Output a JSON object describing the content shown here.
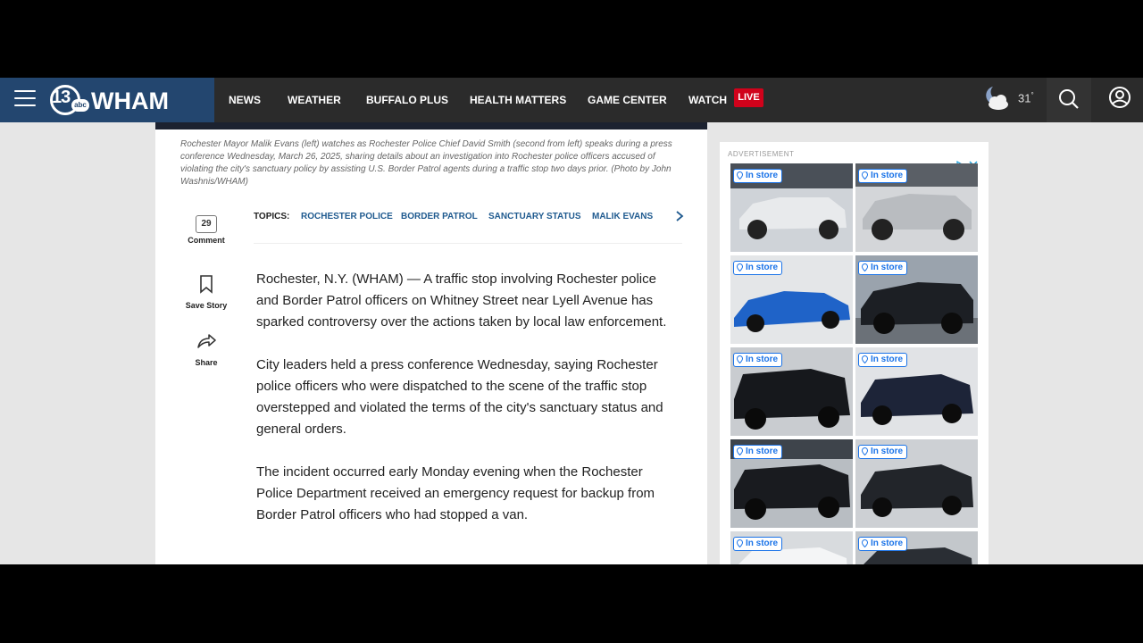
{
  "nav": {
    "brand": {
      "number": "13",
      "network": "abc",
      "name": "WHAM"
    },
    "items": [
      "NEWS",
      "WEATHER",
      "BUFFALO PLUS",
      "HEALTH MATTERS",
      "GAME CENTER",
      "WATCH"
    ],
    "live_label": "LIVE",
    "weather": {
      "temp": "31",
      "unit": "°",
      "icon": "partly-cloudy-night-icon"
    }
  },
  "article": {
    "caption": "Rochester Mayor Malik Evans (left) watches as Rochester Police Chief David Smith (second from left) speaks during a press conference Wednesday, March 26, 2025, sharing details about an investigation into Rochester police officers accused of violating the city's sanctuary policy by assisting U.S. Border Patrol agents during a traffic stop two days prior. (Photo by John Washnis/WHAM)",
    "tools": {
      "comment_count": "29",
      "comment_label": "Comment",
      "save_label": "Save Story",
      "share_label": "Share"
    },
    "topics_label": "TOPICS:",
    "topics": [
      "ROCHESTER POLICE",
      "BORDER PATROL",
      "SANCTUARY STATUS",
      "MALIK EVANS"
    ],
    "paragraphs": [
      "Rochester, N.Y. (WHAM) — A traffic stop involving Rochester police and Border Patrol officers on Whitney Street near Lyell Avenue has sparked controversy over the actions taken by local law enforcement.",
      "City leaders held a press conference Wednesday, saying Rochester police officers who were dispatched to the scene of the traffic stop overstepped and violated the terms of the city's sanctuary status and general orders.",
      "The incident occurred early Monday evening when the Rochester Police Department received an emergency request for backup from Border Patrol officers who had stopped a van."
    ]
  },
  "ad": {
    "label": "ADVERTISEMENT",
    "badge": "In store",
    "tiles": [
      "white-pickup-truck",
      "gray-suv-truck",
      "blue-sports-car",
      "black-pickup-truck",
      "black-luxury-suv",
      "dark-blue-suv",
      "black-truck",
      "black-suv",
      "white-suv",
      "dark-truck"
    ]
  }
}
